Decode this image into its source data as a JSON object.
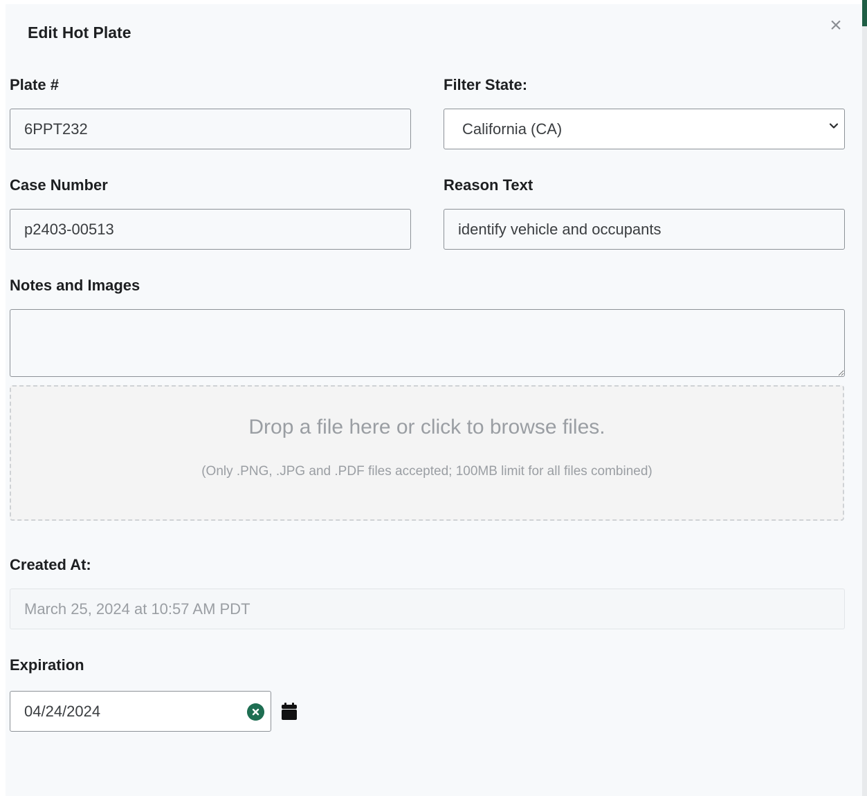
{
  "dialog": {
    "title": "Edit Hot Plate",
    "close_symbol": "×"
  },
  "plate": {
    "label": "Plate #",
    "value": "6PPT232"
  },
  "filter_state": {
    "label": "Filter State:",
    "selected": "California (CA)",
    "icon": "chevron-down-icon"
  },
  "case_number": {
    "label": "Case Number",
    "value": "p2403-00513"
  },
  "reason_text": {
    "label": "Reason Text",
    "value": "identify vehicle and occupants"
  },
  "notes": {
    "label": "Notes and Images",
    "value": ""
  },
  "dropzone": {
    "main_text": "Drop a file here or click to browse files.",
    "sub_text": "(Only .PNG, .JPG and .PDF files accepted; 100MB limit for all files combined)"
  },
  "created_at": {
    "label": "Created At:",
    "value": "March 25, 2024 at 10:57 AM PDT"
  },
  "expiration": {
    "label": "Expiration",
    "value": "04/24/2024",
    "clear_icon": "clear-icon",
    "calendar_icon": "calendar-icon"
  },
  "colors": {
    "accent": "#1e6e52",
    "background": "#f7f9fb",
    "border": "#8c9197"
  }
}
